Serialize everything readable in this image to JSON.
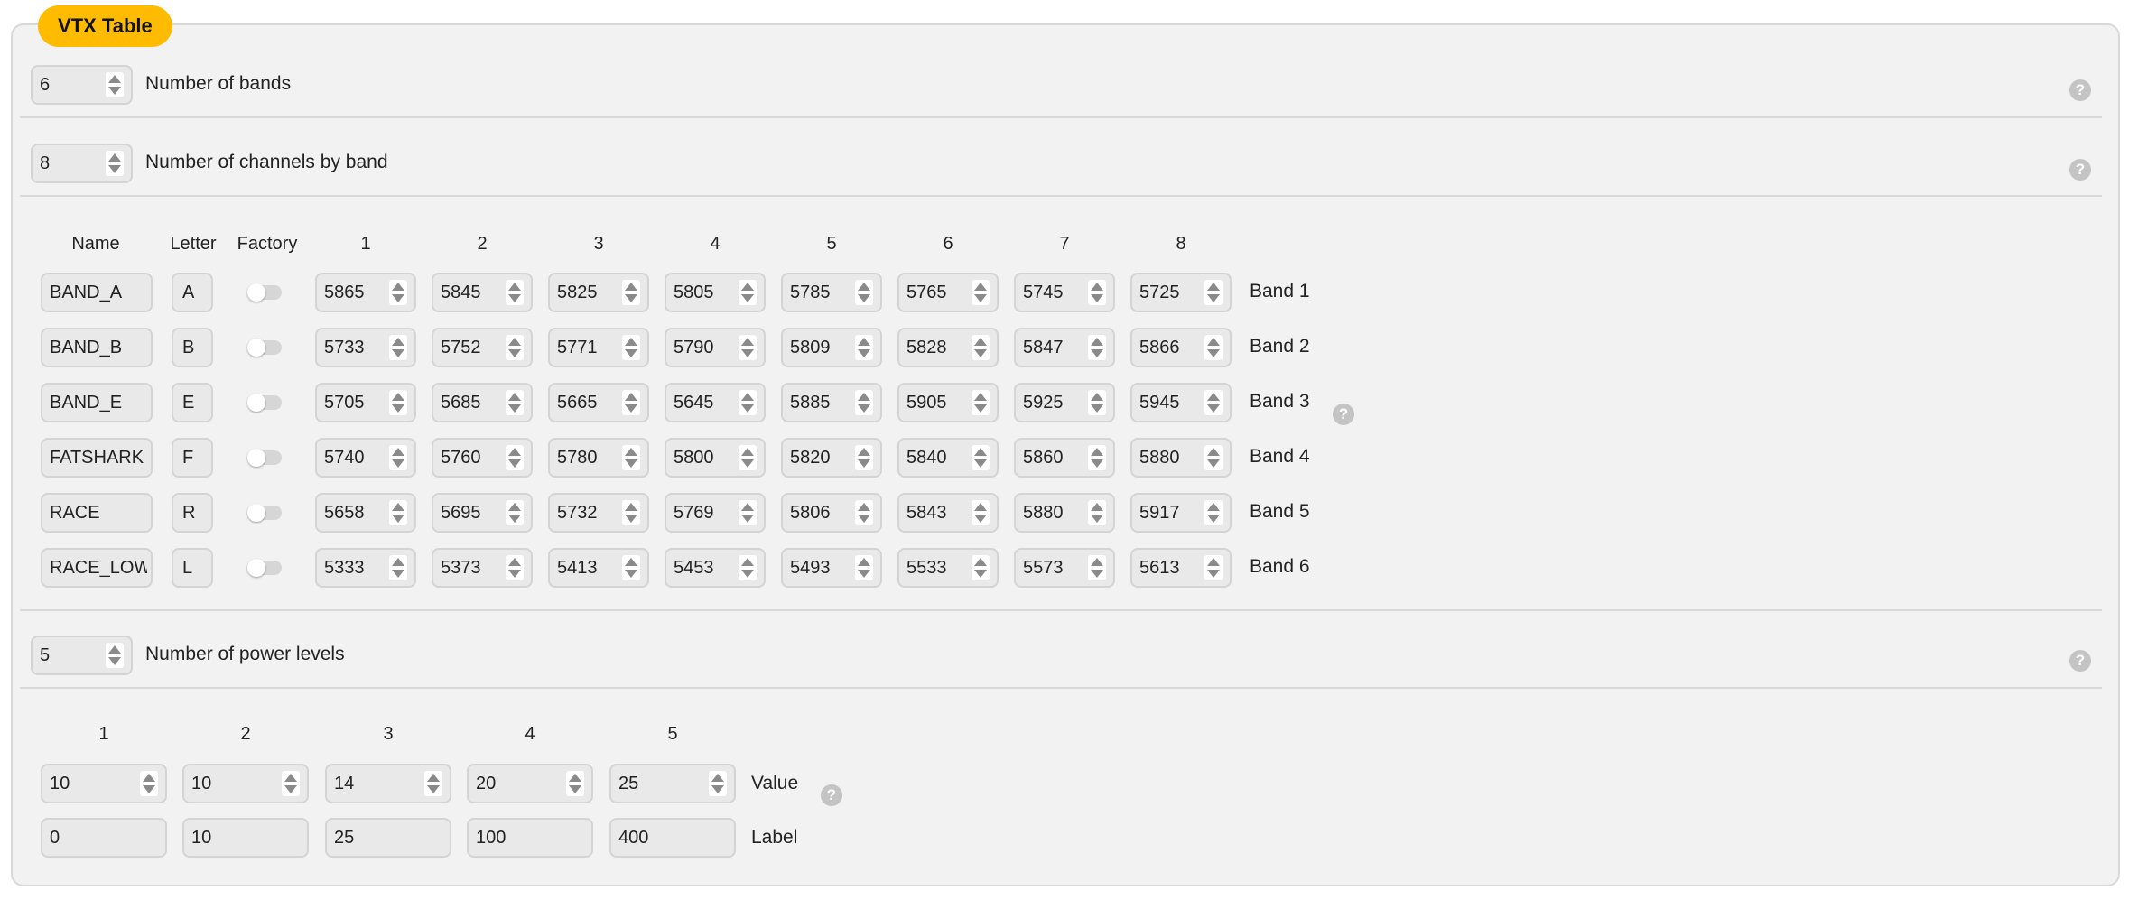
{
  "panel": {
    "title": "VTX Table",
    "accent_color": "#ffbb00"
  },
  "bands_count": {
    "value": "6",
    "label": "Number of bands"
  },
  "channels_count": {
    "value": "8",
    "label": "Number of channels by band"
  },
  "band_table": {
    "headers": {
      "name": "Name",
      "letter": "Letter",
      "factory": "Factory"
    },
    "channel_headers": [
      "1",
      "2",
      "3",
      "4",
      "5",
      "6",
      "7",
      "8"
    ],
    "rows": [
      {
        "name": "BAND_A",
        "letter": "A",
        "factory": false,
        "freqs": [
          "5865",
          "5845",
          "5825",
          "5805",
          "5785",
          "5765",
          "5745",
          "5725"
        ],
        "label": "Band 1"
      },
      {
        "name": "BAND_B",
        "letter": "B",
        "factory": false,
        "freqs": [
          "5733",
          "5752",
          "5771",
          "5790",
          "5809",
          "5828",
          "5847",
          "5866"
        ],
        "label": "Band 2"
      },
      {
        "name": "BAND_E",
        "letter": "E",
        "factory": false,
        "freqs": [
          "5705",
          "5685",
          "5665",
          "5645",
          "5885",
          "5905",
          "5925",
          "5945"
        ],
        "label": "Band 3"
      },
      {
        "name": "FATSHARK",
        "letter": "F",
        "factory": false,
        "freqs": [
          "5740",
          "5760",
          "5780",
          "5800",
          "5820",
          "5840",
          "5860",
          "5880"
        ],
        "label": "Band 4"
      },
      {
        "name": "RACE",
        "letter": "R",
        "factory": false,
        "freqs": [
          "5658",
          "5695",
          "5732",
          "5769",
          "5806",
          "5843",
          "5880",
          "5917"
        ],
        "label": "Band 5"
      },
      {
        "name": "RACE_LOW",
        "letter": "L",
        "factory": false,
        "freqs": [
          "5333",
          "5373",
          "5413",
          "5453",
          "5493",
          "5533",
          "5573",
          "5613"
        ],
        "label": "Band 6"
      }
    ]
  },
  "power_count": {
    "value": "5",
    "label": "Number of power levels"
  },
  "power_table": {
    "headers": [
      "1",
      "2",
      "3",
      "4",
      "5"
    ],
    "values": [
      "10",
      "10",
      "14",
      "20",
      "25"
    ],
    "labels": [
      "0",
      "10",
      "25",
      "100",
      "400"
    ],
    "value_row_label": "Value",
    "label_row_label": "Label"
  },
  "help_icon": "?"
}
